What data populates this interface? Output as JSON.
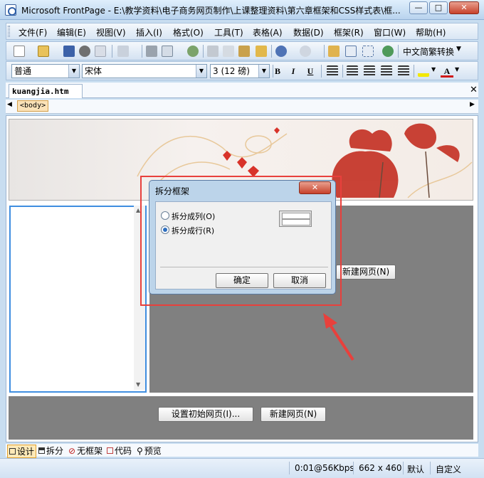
{
  "window": {
    "title": "Microsoft FrontPage - E:\\教学资料\\电子商务网页制作\\上课整理资料\\第六章框架和CSS样式表\\框...",
    "minimize": "—",
    "maximize": "□",
    "close": "✕"
  },
  "menu": [
    "文件(F)",
    "编辑(E)",
    "视图(V)",
    "插入(I)",
    "格式(O)",
    "工具(T)",
    "表格(A)",
    "数据(D)",
    "框架(R)",
    "窗口(W)",
    "帮助(H)"
  ],
  "toolbar": {
    "convert_label": "中文简繁转换"
  },
  "format": {
    "style": "普通",
    "font": "宋体",
    "size": "3 (12 磅)",
    "bold": "B",
    "italic": "I",
    "underline": "U",
    "font_color_letter": "A"
  },
  "document": {
    "tab": "kuangjia.htm",
    "close": "✕",
    "tag": "<body>"
  },
  "frames": {
    "right_new_page": "新建网页(N)",
    "set_initial": "设置初始网页(I)...",
    "bottom_new_page": "新建网页(N)"
  },
  "dialog": {
    "title": "拆分框架",
    "close": "✕",
    "options": [
      {
        "label": "拆分成列(O)",
        "selected": false
      },
      {
        "label": "拆分成行(R)",
        "selected": true
      }
    ],
    "ok": "确定",
    "cancel": "取消"
  },
  "viewbar": [
    "设计",
    "拆分",
    "无框架",
    "代码",
    "预览"
  ],
  "status": {
    "speed": "0:01@56Kbps",
    "size": "662 x 460",
    "mode": "默认",
    "custom": "自定义"
  },
  "colors": {
    "annotation": "#e8403c",
    "frame_selected": "#3f8ee0",
    "frame_gray": "#808080"
  }
}
